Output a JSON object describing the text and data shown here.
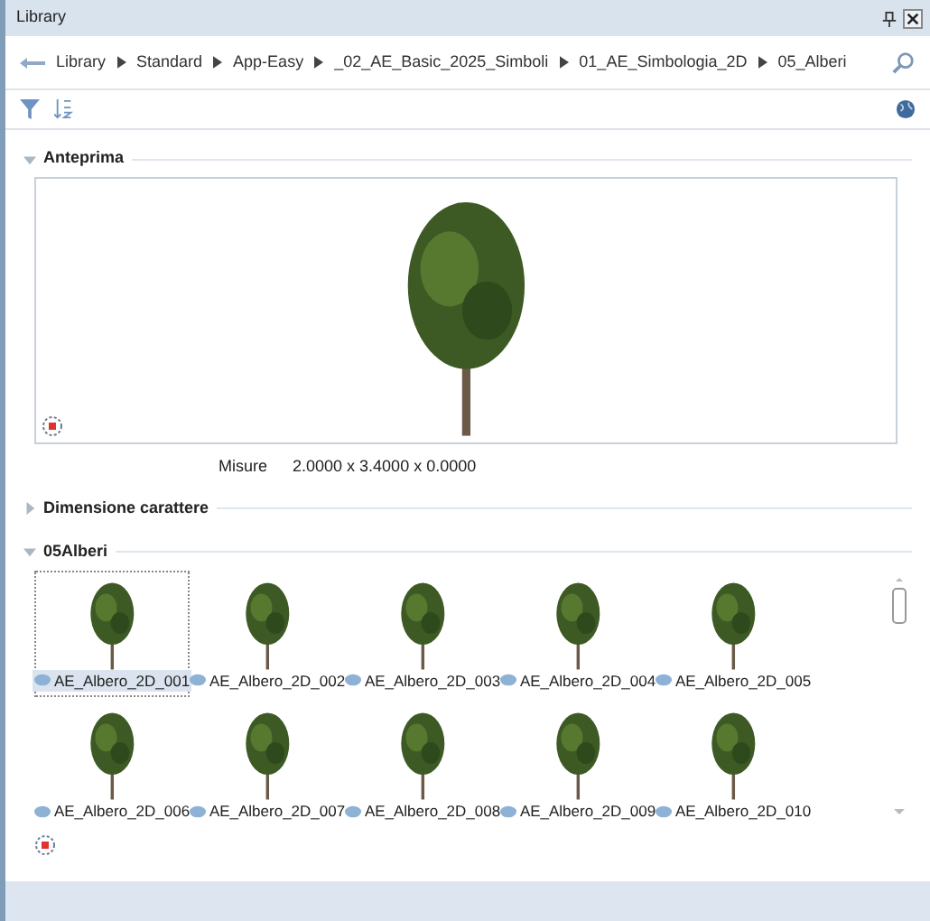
{
  "window": {
    "title": "Library"
  },
  "breadcrumb": [
    "Library",
    "Standard",
    "App-Easy",
    "_02_AE_Basic_2025_Simboli",
    "01_AE_Simbologia_2D",
    "05_Alberi"
  ],
  "sections": [
    {
      "kind": "preview",
      "title": "Anteprima",
      "expanded": true,
      "measure_label": "Misure",
      "measure_value": "2.0000 x 3.4000 x 0.0000"
    },
    {
      "title": "Dimensione carattere",
      "expanded": false
    },
    {
      "kind": "gallery",
      "title": "05Alberi",
      "expanded": true,
      "items": [
        {
          "label": "AE_Albero_2D_001",
          "selected": true
        },
        {
          "label": "AE_Albero_2D_002",
          "selected": false
        },
        {
          "label": "AE_Albero_2D_003",
          "selected": false
        },
        {
          "label": "AE_Albero_2D_004",
          "selected": false
        },
        {
          "label": "AE_Albero_2D_005",
          "selected": false
        },
        {
          "label": "AE_Albero_2D_006",
          "selected": false
        },
        {
          "label": "AE_Albero_2D_007",
          "selected": false
        },
        {
          "label": "AE_Albero_2D_008",
          "selected": false
        },
        {
          "label": "AE_Albero_2D_009",
          "selected": false
        },
        {
          "label": "AE_Albero_2D_010",
          "selected": false
        }
      ]
    }
  ]
}
